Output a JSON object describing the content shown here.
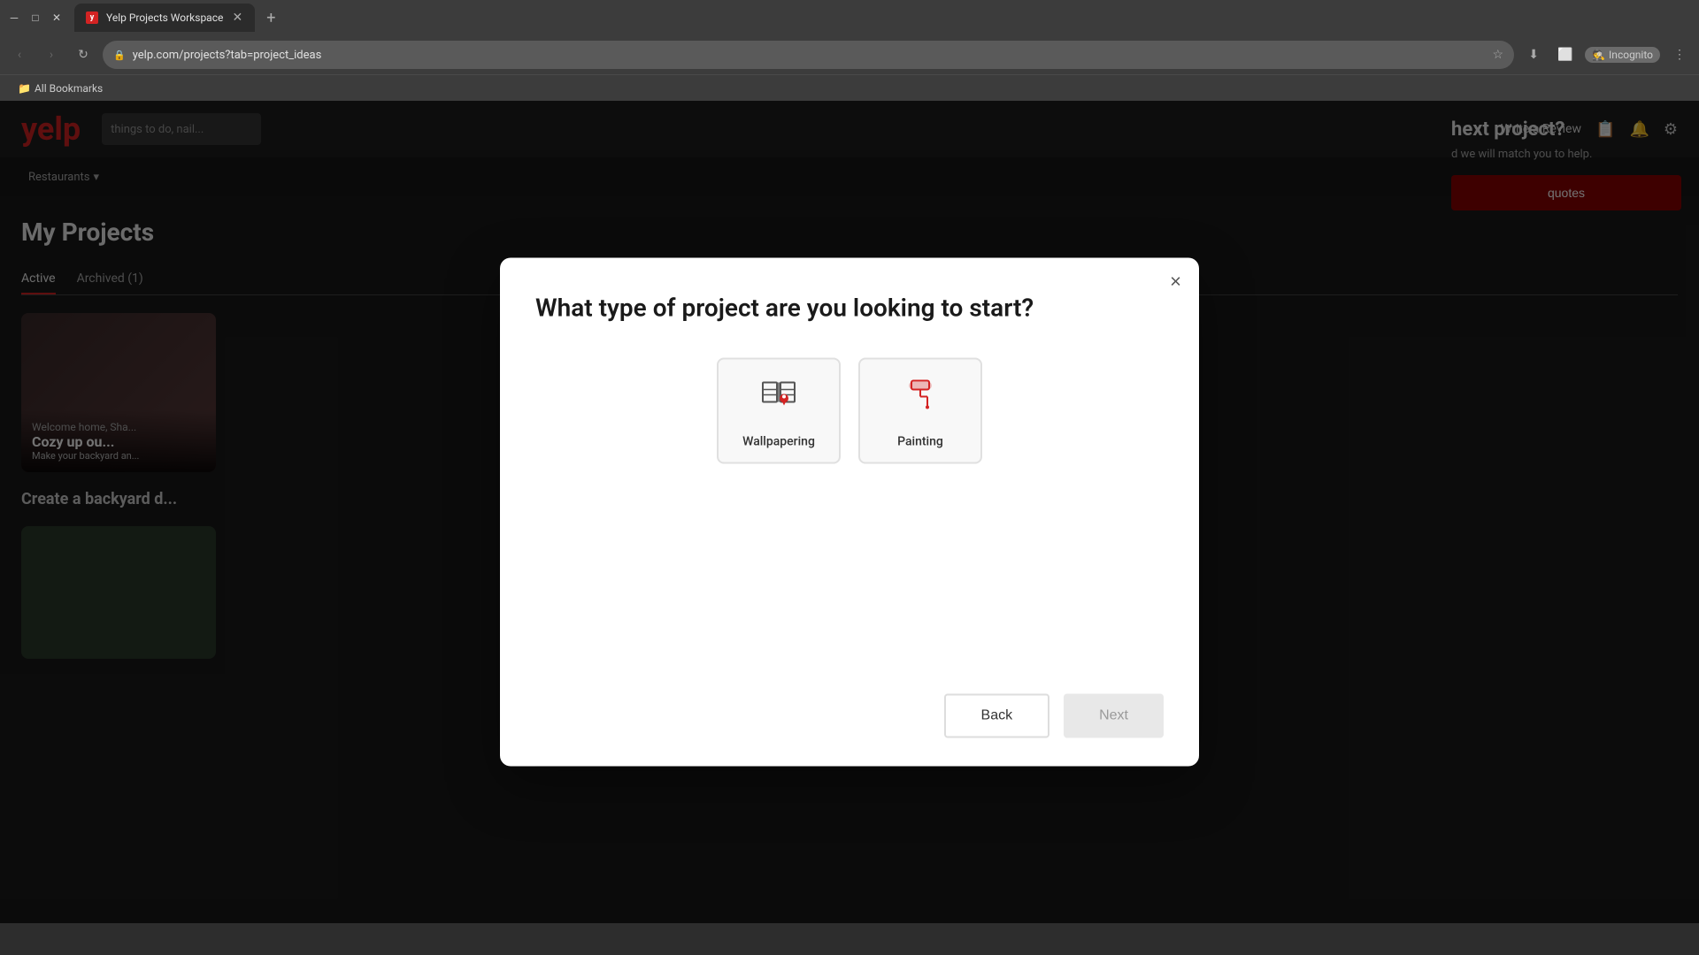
{
  "browser": {
    "tab_title": "Yelp Projects Workspace",
    "url": "yelp.com/projects?tab=project_ideas",
    "new_tab_label": "+",
    "incognito_label": "Incognito",
    "bookmarks_bar_label": "All Bookmarks"
  },
  "yelp_header": {
    "logo": "yelp",
    "search_placeholder": "things to do, nail...",
    "write_review": "Write a Review"
  },
  "yelp_subnav": {
    "restaurants_label": "Restaurants",
    "chevron": "▾"
  },
  "page": {
    "my_projects_title": "My Projects",
    "tab_active": "Active",
    "tab_archived": "Archived (1)",
    "card1_welcome": "Welcome home, Sha...",
    "card1_title": "Cozy up ou...",
    "card1_body": "Make your backyard an...",
    "card2_create": "Create a backyard d...",
    "next_project_title": "hext project?",
    "next_project_desc": "d we will match you to help.",
    "get_quotes_label": "quotes"
  },
  "modal": {
    "title": "What type of project are you looking to start?",
    "close_label": "×",
    "options": [
      {
        "id": "wallpapering",
        "label": "Wallpapering",
        "selected": false
      },
      {
        "id": "painting",
        "label": "Painting",
        "selected": false
      }
    ],
    "back_label": "Back",
    "next_label": "Next"
  }
}
